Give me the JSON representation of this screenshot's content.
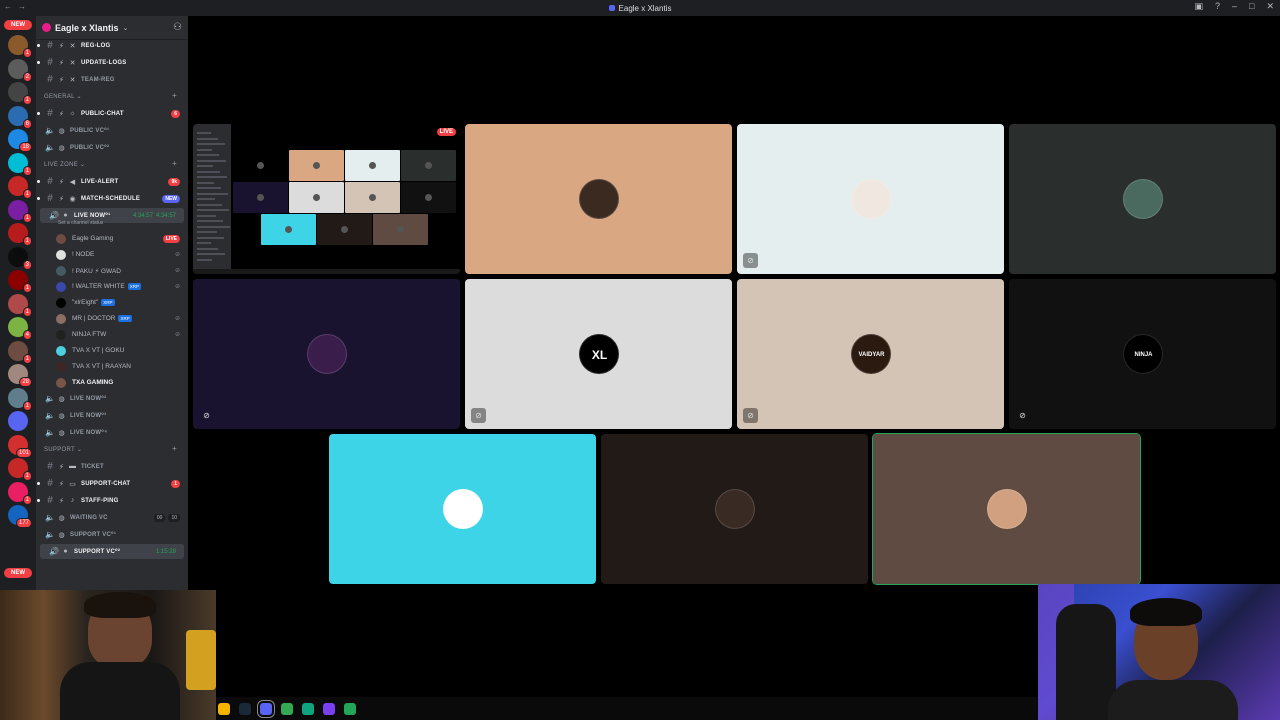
{
  "window": {
    "title": "Eagle x Xlantis"
  },
  "guild": {
    "name": "Eagle x Xlantis"
  },
  "rail": {
    "new_top": "NEW",
    "new_bottom": "NEW",
    "servers": [
      {
        "color": "#8b5a2b",
        "badge": "1"
      },
      {
        "color": "#5c5c5c",
        "badge": "2"
      },
      {
        "color": "#444",
        "badge": "1"
      },
      {
        "color": "#2b6cb0",
        "badge": "6"
      },
      {
        "color": "#1e88e5",
        "badge": "18"
      },
      {
        "color": "#00bcd4",
        "badge": "1"
      },
      {
        "color": "#c62828",
        "badge": "1"
      },
      {
        "color": "#7b1fa2",
        "badge": "1"
      },
      {
        "color": "#b71c1c",
        "badge": "1"
      },
      {
        "color": "#0d0d0d",
        "badge": "3"
      },
      {
        "color": "#8b0000",
        "badge": "1"
      },
      {
        "color": "#b04a4a",
        "badge": "1"
      },
      {
        "color": "#7cb342",
        "badge": "4"
      },
      {
        "color": "#6d4c41",
        "badge": "1"
      },
      {
        "color": "#a1887f",
        "badge": "28"
      },
      {
        "color": "#607d8b",
        "badge": "1"
      },
      {
        "color": "#5865f2",
        "badge": ""
      },
      {
        "color": "#d32f2f",
        "badge": "101"
      },
      {
        "color": "#c62828",
        "badge": "1"
      },
      {
        "color": "#e91e63",
        "badge": "1"
      },
      {
        "color": "#1565c0",
        "badge": "177"
      }
    ]
  },
  "channels": {
    "top": [
      {
        "emoji": "✕",
        "label": "REG-LOG",
        "bright": true
      },
      {
        "emoji": "✕",
        "label": "UPDATE-LOGS",
        "bright": true
      },
      {
        "emoji": "✕",
        "label": "TEAM-REG",
        "bright": false
      }
    ],
    "general": {
      "category": "GENERAL",
      "text": [
        {
          "emoji": "☼",
          "label": "PUBLIC-CHAT",
          "badge": "6"
        }
      ],
      "voice": [
        {
          "label": "PUBLIC VC⁰¹"
        },
        {
          "label": "PUBLIC VC⁰²"
        }
      ]
    },
    "live_zone": {
      "category": "LIVE ZONE",
      "text": [
        {
          "emoji": "◀",
          "label": "LIVE-ALERT",
          "badge": "9k"
        },
        {
          "emoji": "◉",
          "label": "MATCH-SCHEDULE",
          "badge": "NEW"
        }
      ],
      "active_voice": {
        "label": "LIVE NOW⁰¹",
        "time": "4:34:57",
        "status": "Set a channel status"
      },
      "members": [
        {
          "name": "Eagle Gaming",
          "tag": "",
          "live": "LIVE",
          "color": "#6d4c41"
        },
        {
          "name": "! NODE",
          "tag": "",
          "live": "",
          "color": "#e0e0e0"
        },
        {
          "name": "! PAKU ⚡ GWAD",
          "tag": "",
          "live": "",
          "color": "#455a64"
        },
        {
          "name": "! WALTER WHITE",
          "tag": "XRP",
          "live": "",
          "color": "#3949ab"
        },
        {
          "name": "\"xlrEight\"",
          "tag": "XRP",
          "live": "",
          "color": "#000000"
        },
        {
          "name": "MR | DOCTOR",
          "tag": "XRP",
          "live": "",
          "color": "#8d6e63"
        },
        {
          "name": "NINJA FTW",
          "tag": "",
          "live": "",
          "color": "#212121"
        },
        {
          "name": "TVA X VT | GOKU",
          "tag": "",
          "live": "",
          "color": "#4dd0e1"
        },
        {
          "name": "TVA X VT | RAAYAN",
          "tag": "",
          "live": "",
          "color": "#3e2723"
        },
        {
          "name": "TXA GAMING",
          "tag": "",
          "live": "",
          "color": "#795548"
        }
      ],
      "voice": [
        {
          "label": "LIVE NOW⁰²"
        },
        {
          "label": "LIVE NOW⁰³"
        },
        {
          "label": "LIVE NOW⁰⁴"
        }
      ]
    },
    "support": {
      "category": "SUPPORT",
      "text": [
        {
          "emoji": "▬",
          "label": "TICKET",
          "badge": "",
          "bright": false
        },
        {
          "emoji": "▭",
          "label": "SUPPORT-CHAT",
          "badge": "1",
          "bright": true
        },
        {
          "emoji": "♪",
          "label": "STAFF-PING",
          "badge": "",
          "bright": true
        }
      ],
      "voice": [
        {
          "label": "WAITING VC",
          "count_a": "00",
          "count_b": "10",
          "time": ""
        },
        {
          "label": "SUPPORT VC⁰¹",
          "count_a": "",
          "count_b": "",
          "time": ""
        },
        {
          "label": "SUPPORT VC⁰²",
          "count_a": "",
          "count_b": "",
          "time": "1:15:28"
        }
      ]
    }
  },
  "stage": {
    "live_badge": "LIVE",
    "tiles": [
      {
        "name": "screenshare",
        "bg": "#000000",
        "avatar": "",
        "muted": false
      },
      {
        "name": "tile-tan",
        "bg": "#d9a882",
        "avatar": "#3a2a20",
        "muted": false
      },
      {
        "name": "tile-light",
        "bg": "#e5eeee",
        "avatar": "#f0e8e0",
        "muted": true
      },
      {
        "name": "tile-dark-grey",
        "bg": "#2a2e2d",
        "avatar": "#4a6a60",
        "muted": false
      },
      {
        "name": "tile-navy",
        "bg": "#1a1330",
        "avatar": "#3a1d4a",
        "muted": true
      },
      {
        "name": "tile-silver",
        "bg": "#dcdcdc",
        "avatar": "#000000",
        "muted": true
      },
      {
        "name": "tile-beige",
        "bg": "#d4c4b6",
        "avatar": "#2a1a10",
        "muted": true
      },
      {
        "name": "tile-black",
        "bg": "#111111",
        "avatar": "#000000",
        "muted": true
      },
      {
        "name": "tile-cyan",
        "bg": "#3dd4e8",
        "avatar": "#ffffff",
        "muted": false
      },
      {
        "name": "tile-brown-dark",
        "bg": "#211a17",
        "avatar": "#3a2a24",
        "muted": false
      },
      {
        "name": "tile-brown",
        "bg": "#5f4b42",
        "avatar": "#d0a080",
        "muted": false
      }
    ],
    "avatar_texts": [
      "XL",
      "VAIDYAR",
      "NINJA"
    ]
  },
  "taskbar": {
    "icons": [
      {
        "name": "chrome-icon",
        "color": "#f4b400"
      },
      {
        "name": "steam-icon",
        "color": "#1b2838"
      },
      {
        "name": "discord-icon",
        "color": "#5865f2"
      },
      {
        "name": "browser-icon",
        "color": "#34a853"
      },
      {
        "name": "app-green-icon",
        "color": "#10a37f"
      },
      {
        "name": "app-purple-icon",
        "color": "#7b3ff2"
      },
      {
        "name": "app-lambda-icon",
        "color": "#23a55a"
      }
    ]
  }
}
